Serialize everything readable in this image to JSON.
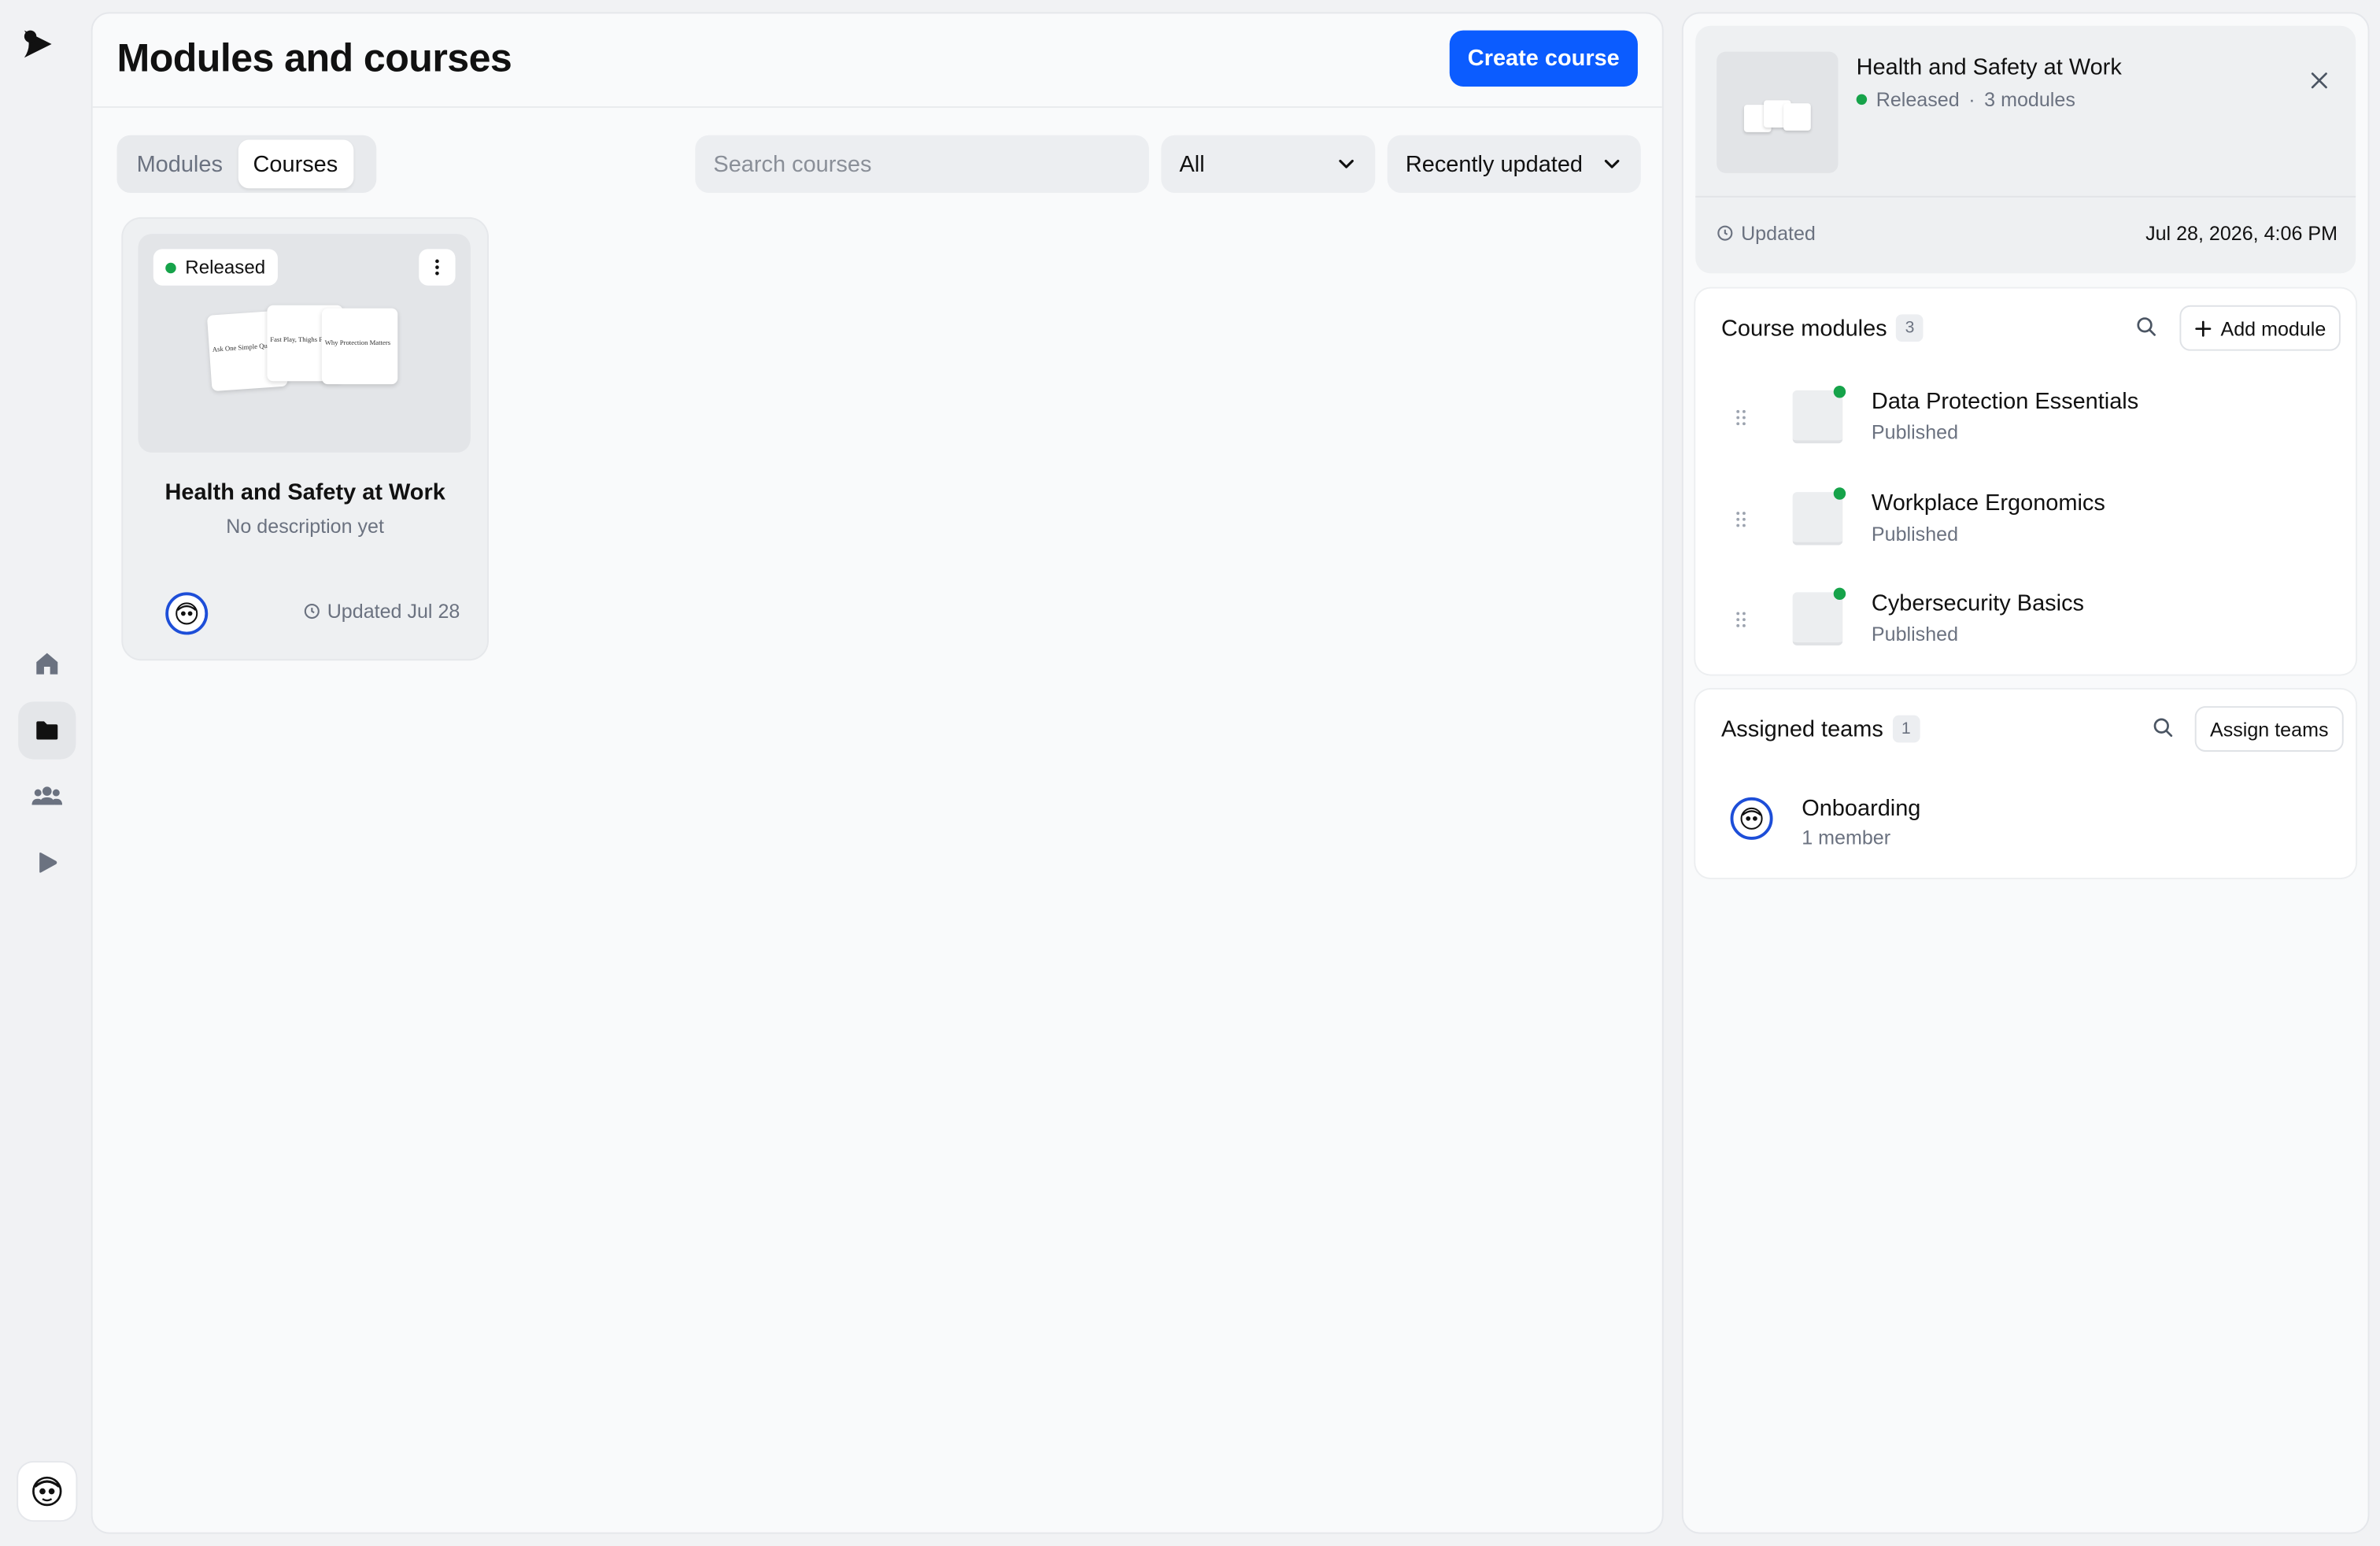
{
  "app": {
    "nav": [
      {
        "name": "home",
        "icon": "home-icon"
      },
      {
        "name": "courses",
        "icon": "folder-icon",
        "active": true
      },
      {
        "name": "teams",
        "icon": "users-icon"
      },
      {
        "name": "player",
        "icon": "play-icon"
      }
    ],
    "accent": "#0b5cff",
    "status_green": "#16a34a"
  },
  "header": {
    "title": "Modules and courses",
    "create_label": "Create course"
  },
  "toolbar": {
    "tabs": [
      "Modules",
      "Courses"
    ],
    "active_tab": "Courses",
    "search_placeholder": "Search courses",
    "filter_value": "All",
    "sort_value": "Recently updated"
  },
  "card": {
    "status": "Released",
    "title": "Health and Safety at Work",
    "description": "No description yet",
    "updated": "Updated Jul 28",
    "thumb_pages": [
      "Ask One Simple Qu",
      "Fast Play, Thighs F",
      "Why Protection Matters"
    ]
  },
  "detail": {
    "title": "Health and Safety at Work",
    "status": "Released",
    "separator": "·",
    "modules_count": "3 modules",
    "updated_label": "Updated",
    "updated_value": "Jul 28, 2026, 4:06 PM",
    "modules_section": {
      "title": "Course modules",
      "count": "3",
      "add_label": "Add module",
      "items": [
        {
          "title": "Data Protection Essentials",
          "status": "Published"
        },
        {
          "title": "Workplace Ergonomics",
          "status": "Published"
        },
        {
          "title": "Cybersecurity Basics",
          "status": "Published"
        }
      ]
    },
    "teams_section": {
      "title": "Assigned teams",
      "count": "1",
      "assign_label": "Assign teams",
      "items": [
        {
          "title": "Onboarding",
          "members": "1 member"
        }
      ]
    }
  }
}
